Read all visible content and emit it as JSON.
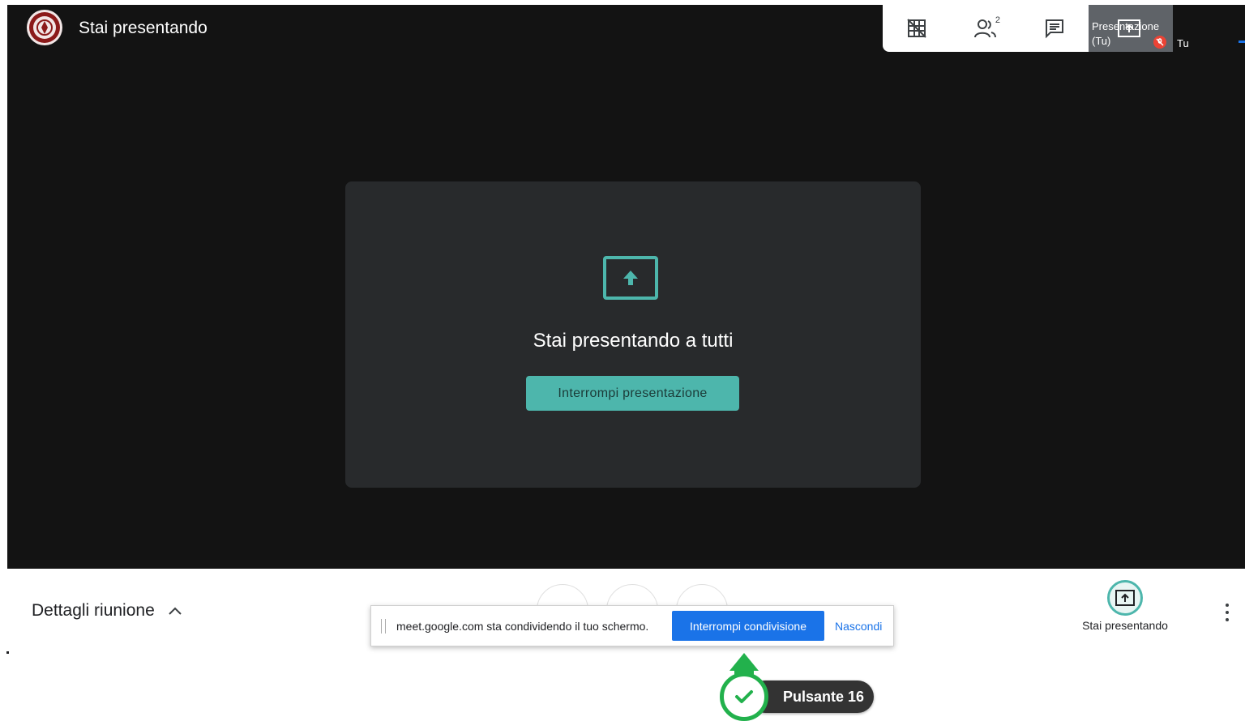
{
  "header": {
    "title": "Stai presentando",
    "logo": "university-seal-icon"
  },
  "toolbar": {
    "layout_icon": "grid-off-icon",
    "people_icon": "people-icon",
    "participant_count": "2",
    "chat_icon": "chat-icon"
  },
  "self_tile": {
    "label": "Presentazione (Tu)",
    "you_label": "Tu",
    "mic_icon": "mic-off-icon"
  },
  "present_card": {
    "icon": "present-to-all-icon",
    "message": "Stai presentando a tutti",
    "stop_button": "Interrompi presentazione"
  },
  "bottom_bar": {
    "meeting_details": "Dettagli riunione",
    "chevron_icon": "chevron-up-icon",
    "presenting_label": "Stai presentando",
    "more_icon": "more-vert-icon"
  },
  "share_bar": {
    "message": "meet.google.com sta condividendo il tuo schermo.",
    "stop_sharing": "Interrompi condivisione",
    "hide": "Nascondi"
  },
  "tutorial_marker": {
    "label": "Pulsante 16",
    "icon": "check-icon"
  },
  "colors": {
    "stage_bg": "#131313",
    "card_bg": "#282a2c",
    "accent_teal": "#4db6ac",
    "chrome_blue": "#1a73e8",
    "marker_green": "#22b14c"
  }
}
